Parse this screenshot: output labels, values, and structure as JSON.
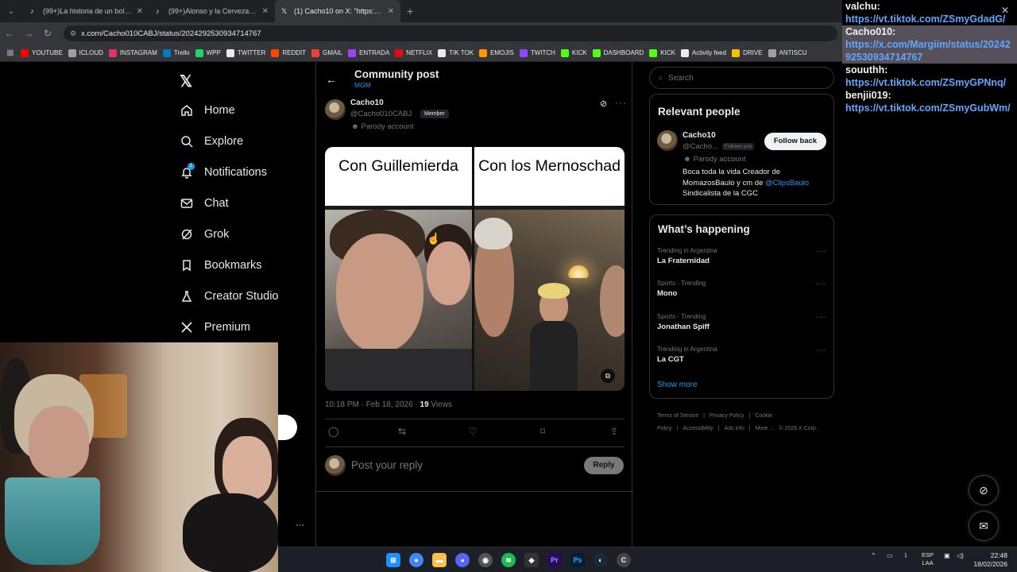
{
  "browser": {
    "tabs": [
      {
        "title": "(99+)La historia de un boludo c",
        "icon": "tiktok-icon",
        "active": false
      },
      {
        "title": "(99+)Alonso y la Cerveza: Un M",
        "icon": "tiktok-icon",
        "active": false
      },
      {
        "title": "(1) Cacho10 on X: \"https://t.co/",
        "icon": "x-icon",
        "active": true
      }
    ],
    "url": "x.com/Cacho010CABJ/status/2024292530934714767",
    "bookmarks": [
      "YOUTUBE",
      "ICLOUD",
      "INSTAGRAM",
      "Trello",
      "WPP",
      "TWITTER",
      "REDDIT",
      "GMAIL",
      "ENTRADA",
      "NETFLIX",
      "TIK TOK",
      "EMOJIS",
      "TWITCH",
      "KICK",
      "DASHBOARD",
      "KICK",
      "Activity feed",
      "DRIVE",
      "ANTISCU"
    ],
    "bookmark_colors": [
      "#ff0000",
      "#9aa0a6",
      "#e1306c",
      "#0079bf",
      "#25d366",
      "#e8eaed",
      "#ff4500",
      "#ea4335",
      "#a142f4",
      "#e50914",
      "#e8eaed",
      "#ff9800",
      "#9146ff",
      "#53fc18",
      "#53fc18",
      "#53fc18",
      "#e8eaed",
      "#fbbc04",
      "#9aa0a6"
    ]
  },
  "chat": {
    "messages": [
      {
        "user": "valchu:",
        "text": "https://vt.tiktok.com/ZSmyGdadG/",
        "highlight": false
      },
      {
        "user": "Cacho010:",
        "text": "https://x.com/Margiim/status/2024292530934714767",
        "highlight": true
      },
      {
        "user": "souuthh:",
        "text": "https://vt.tiktok.com/ZSmyGPNnq/",
        "highlight": false
      },
      {
        "user": "benjii019:",
        "text": "https://vt.tiktok.com/ZSmyGubWm/",
        "highlight": false
      }
    ]
  },
  "nav": {
    "items": [
      {
        "label": "Home",
        "icon": "home-icon"
      },
      {
        "label": "Explore",
        "icon": "search-icon"
      },
      {
        "label": "Notifications",
        "icon": "bell-icon"
      },
      {
        "label": "Chat",
        "icon": "mail-icon"
      },
      {
        "label": "Grok",
        "icon": "grok-icon"
      },
      {
        "label": "Bookmarks",
        "icon": "bookmark-icon"
      },
      {
        "label": "Creator Studio",
        "icon": "flask-icon"
      },
      {
        "label": "Premium",
        "icon": "x-premium-icon"
      }
    ],
    "notifications_badge": "1"
  },
  "post": {
    "header_title": "Community post",
    "header_sub": "MGM",
    "name": "Cacho10",
    "handle": "@Cacho010CABJ",
    "member_badge": "Member",
    "parody": "Parody account",
    "caption_left": "Con Guillemierda",
    "caption_right": "Con los Mernoschad",
    "time": "10:18 PM · Feb 18, 2026 · ",
    "views_count": "19",
    "views_label": " Views",
    "reply_placeholder": "Post your reply",
    "reply_button": "Reply"
  },
  "sidebar": {
    "search_placeholder": "Search",
    "relevant_title": "Relevant people",
    "person": {
      "name": "Cacho10",
      "handle": "@Cacho...",
      "follows_you": "Follows you",
      "follow_button": "Follow back",
      "parody": "Parody account",
      "bio": "Boca toda la vida Creador de MomazosBaulo y cm de ",
      "bio_mention": "@ClipsBaulo",
      "bio_end": " Sindicalista de la CGC"
    },
    "happening_title": "What’s happening",
    "trends": [
      {
        "context": "Trending in Argentina",
        "name": "La Fraternidad"
      },
      {
        "context": "Sports · Trending",
        "name": "Mono"
      },
      {
        "context": "Sports · Trending",
        "name": "Jonathan Spiff"
      },
      {
        "context": "Trending in Argentina",
        "name": "La CGT"
      }
    ],
    "show_more": "Show more",
    "footer": [
      "Terms of Service",
      "|",
      "Privacy Policy",
      "|",
      "Cookie Policy",
      "|",
      "Accessibility",
      "|",
      "Ads info",
      "|",
      "More ...",
      "© 2026 X Corp."
    ]
  },
  "taskbar": {
    "lang_top": "ESP",
    "lang_bottom": "LAA",
    "time": "22:48",
    "date": "18/02/2026"
  }
}
